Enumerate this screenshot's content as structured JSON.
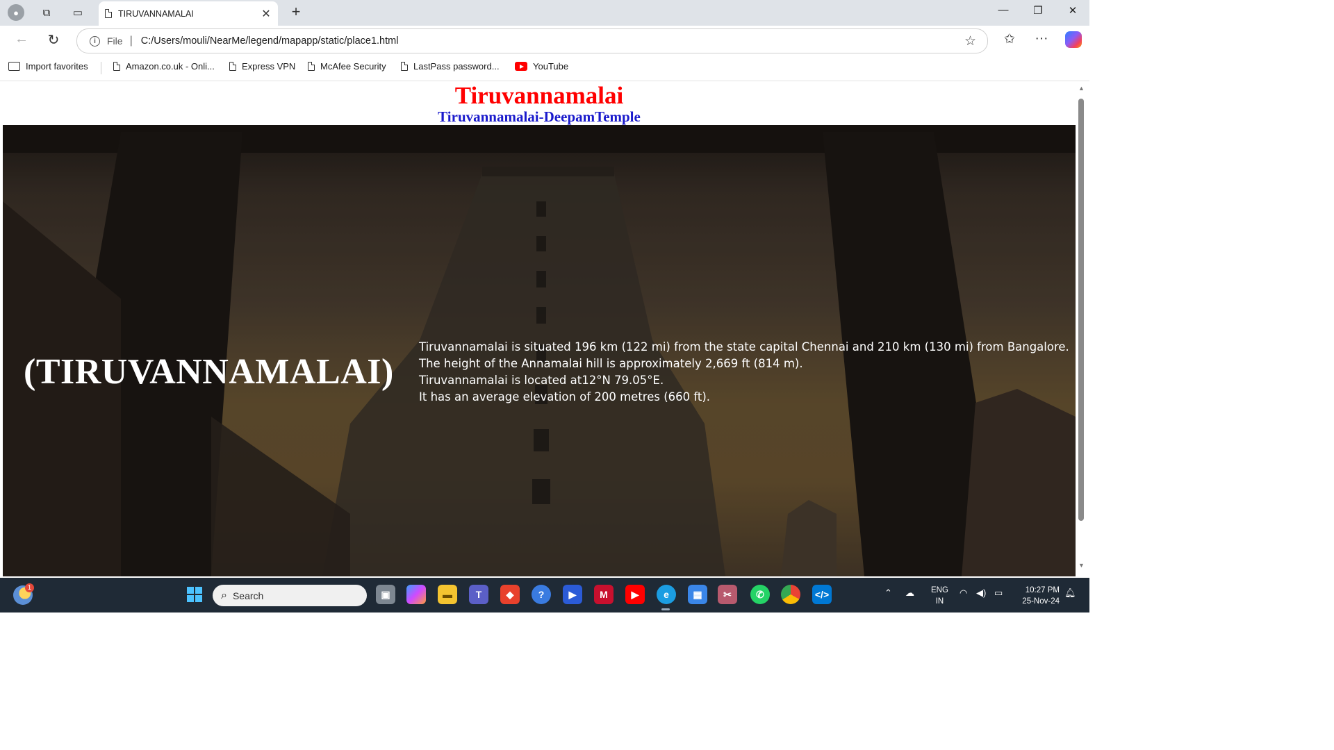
{
  "browser": {
    "tab_title": "TIRUVANNAMALAI",
    "new_tab_symbol": "+",
    "close_tab_symbol": "✕",
    "address": {
      "scheme_label": "File",
      "url": "C:/Users/mouli/NearMe/legend/mapapp/static/place1.html"
    },
    "favorites": [
      {
        "label": "Import favorites",
        "icon": "import-favorites-icon"
      },
      {
        "label": "Amazon.co.uk - Onli...",
        "icon": "page-icon"
      },
      {
        "label": "Express VPN",
        "icon": "page-icon"
      },
      {
        "label": "McAfee Security",
        "icon": "page-icon"
      },
      {
        "label": "LastPass password...",
        "icon": "page-icon"
      },
      {
        "label": "YouTube",
        "icon": "youtube-icon"
      }
    ]
  },
  "page": {
    "title": "Tiruvannamalai",
    "subtitle": "Tiruvannamalai-DeepamTemple",
    "hero_name": "(TIRUVANNAMALAI)",
    "info_lines": [
      "Tiruvannamalai is situated 196 km (122 mi) from the state capital Chennai and 210 km (130 mi) from Bangalore.",
      "The height of the Annamalai hill is approximately 2,669 ft (814 m).",
      "Tiruvannamalai is located at12°N 79.05°E.",
      "It has an average elevation of 200 metres (660 ft)."
    ],
    "colors": {
      "title": "#ff0000",
      "subtitle": "#1a1acc",
      "hero_text": "#ffffff"
    }
  },
  "taskbar": {
    "weather_badge": "1",
    "search_placeholder": "Search",
    "language": "ENG",
    "region": "IN",
    "time": "10:27 PM",
    "date": "25-Nov-24"
  }
}
